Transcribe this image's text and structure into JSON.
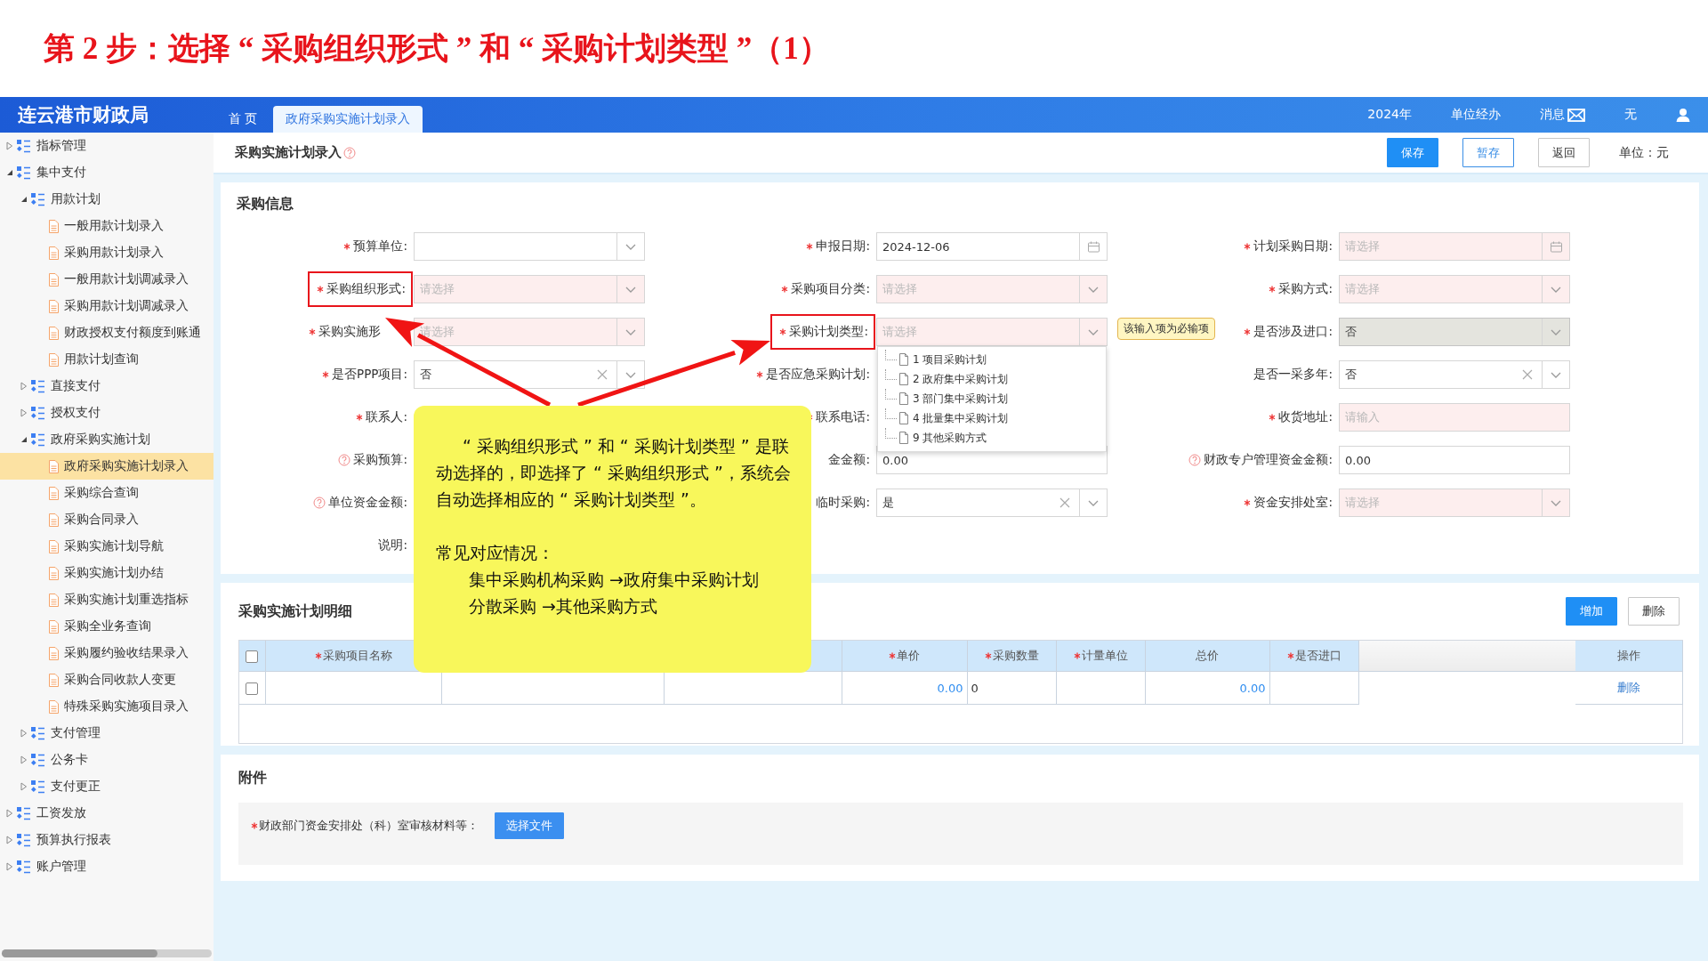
{
  "slide_title": "第 2 步：选择 “ 采购组织形式 ” 和 “ 采购计划类型 ”（1）",
  "header": {
    "logo": "连云港市财政局",
    "tabs": [
      {
        "label": "首 页",
        "selected": false
      },
      {
        "label": "政府采购实施计划录入",
        "selected": true
      }
    ],
    "items": [
      {
        "kind": "text",
        "text": "2024年"
      },
      {
        "kind": "text",
        "text": "单位经办"
      },
      {
        "kind": "message",
        "text": "消息"
      },
      {
        "kind": "text",
        "text": "无"
      },
      {
        "kind": "user"
      }
    ]
  },
  "sidebar": {
    "items": [
      {
        "label": "指标管理",
        "kind": "folder",
        "expanded": false,
        "selected": false
      },
      {
        "label": "集中支付",
        "kind": "folder",
        "expanded": true,
        "selected": false,
        "children": [
          {
            "label": "用款计划",
            "kind": "folder",
            "expanded": true,
            "selected": false,
            "children": [
              {
                "label": "一般用款计划录入",
                "kind": "page",
                "selected": false
              },
              {
                "label": "采购用款计划录入",
                "kind": "page",
                "selected": false
              },
              {
                "label": "一般用款计划调减录入",
                "kind": "page",
                "selected": false
              },
              {
                "label": "采购用款计划调减录入",
                "kind": "page",
                "selected": false
              },
              {
                "label": "财政授权支付额度到账通",
                "kind": "page",
                "selected": false
              },
              {
                "label": "用款计划查询",
                "kind": "page",
                "selected": false
              }
            ]
          },
          {
            "label": "直接支付",
            "kind": "folder",
            "expanded": false,
            "selected": false
          },
          {
            "label": "授权支付",
            "kind": "folder",
            "expanded": false,
            "selected": false
          },
          {
            "label": "政府采购实施计划",
            "kind": "folder",
            "expanded": true,
            "selected": false,
            "children": [
              {
                "label": "政府采购实施计划录入",
                "kind": "page",
                "selected": true
              },
              {
                "label": "采购综合查询",
                "kind": "page",
                "selected": false
              },
              {
                "label": "采购合同录入",
                "kind": "page",
                "selected": false
              },
              {
                "label": "采购实施计划导航",
                "kind": "page",
                "selected": false
              },
              {
                "label": "采购实施计划办结",
                "kind": "page",
                "selected": false
              },
              {
                "label": "采购实施计划重选指标",
                "kind": "page",
                "selected": false
              },
              {
                "label": "采购全业务查询",
                "kind": "page",
                "selected": false
              },
              {
                "label": "采购履约验收结果录入",
                "kind": "page",
                "selected": false
              },
              {
                "label": "采购合同收款人变更",
                "kind": "page",
                "selected": false
              },
              {
                "label": "特殊采购实施项目录入",
                "kind": "page",
                "selected": false
              }
            ]
          },
          {
            "label": "支付管理",
            "kind": "folder",
            "expanded": false,
            "selected": false
          },
          {
            "label": "公务卡",
            "kind": "folder",
            "expanded": false,
            "selected": false
          },
          {
            "label": "支付更正",
            "kind": "folder",
            "expanded": false,
            "selected": false
          }
        ]
      },
      {
        "label": "工资发放",
        "kind": "folder",
        "expanded": false,
        "selected": false
      },
      {
        "label": "预算执行报表",
        "kind": "folder",
        "expanded": false,
        "selected": false
      },
      {
        "label": "账户管理",
        "kind": "folder",
        "expanded": false,
        "selected": false
      }
    ]
  },
  "toolbar": {
    "title": "采购实施计划录入",
    "buttons": [
      {
        "label": "保存",
        "kind": "primary"
      },
      {
        "label": "暂存",
        "kind": "outline"
      },
      {
        "label": "返回",
        "kind": "default"
      }
    ],
    "unit": "单位：元"
  },
  "form": {
    "title": "采购信息",
    "fields": [
      {
        "label": "预算单位:",
        "required": true,
        "help": false,
        "kind": "select",
        "invalid": false,
        "disabled": false,
        "highlighted": false,
        "clearable": false
      },
      {
        "label": "申报日期:",
        "required": true,
        "help": false,
        "kind": "date",
        "value": "2024-12-06",
        "invalid": false,
        "disabled": false,
        "highlighted": false,
        "clearable": false
      },
      {
        "label": "计划采购日期:",
        "required": true,
        "help": false,
        "kind": "date",
        "placeholder": "请选择",
        "invalid": true,
        "disabled": false,
        "highlighted": false,
        "clearable": false
      },
      {
        "label": "采购组织形式:",
        "required": true,
        "help": false,
        "kind": "select",
        "placeholder": "请选择",
        "invalid": true,
        "disabled": false,
        "highlighted": true,
        "clearable": false
      },
      {
        "label": "采购项目分类:",
        "required": true,
        "help": false,
        "kind": "select",
        "placeholder": "请选择",
        "invalid": true,
        "disabled": false,
        "highlighted": false,
        "clearable": false
      },
      {
        "label": "采购方式:",
        "required": true,
        "help": false,
        "kind": "select",
        "placeholder": "请选择",
        "invalid": true,
        "disabled": false,
        "highlighted": false,
        "clearable": false
      },
      {
        "label": "采购实施形",
        "required": true,
        "help": false,
        "kind": "select",
        "placeholder": "请选择",
        "invalid": true,
        "disabled": false,
        "highlighted": false,
        "clearable": false
      },
      {
        "label": "采购计划类型:",
        "required": true,
        "help": false,
        "kind": "select",
        "placeholder": "请选择",
        "invalid": true,
        "disabled": false,
        "highlighted": true,
        "clearable": false,
        "dropdown": {
          "options": [
            "1 项目采购计划",
            "2 政府集中采购计划",
            "3 部门集中采购计划",
            "4 批量集中采购计划",
            "9 其他采购方式"
          ]
        },
        "tooltip": "该输入项为必输项"
      },
      {
        "label": "是否涉及进口:",
        "required": true,
        "help": false,
        "kind": "select",
        "value": "否",
        "invalid": false,
        "disabled": true,
        "highlighted": false,
        "clearable": false
      },
      {
        "label": "是否PPP项目:",
        "required": true,
        "help": false,
        "kind": "select",
        "value": "否",
        "invalid": false,
        "disabled": false,
        "highlighted": false,
        "clearable": true
      },
      {
        "label": "是否应急采购计划:",
        "required": true,
        "help": false
      },
      {
        "label": "是否一采多年:",
        "required": false,
        "help": false,
        "kind": "select",
        "value": "否",
        "invalid": false,
        "disabled": false,
        "highlighted": false,
        "clearable": true
      },
      {
        "label": "联系人:",
        "required": true,
        "help": false
      },
      {
        "label": "联系电话:",
        "required": true,
        "help": false
      },
      {
        "label": "收货地址:",
        "required": true,
        "help": false,
        "kind": "input",
        "placeholder": "请输入",
        "invalid": true,
        "disabled": false,
        "highlighted": false,
        "clearable": false
      },
      {
        "label": "采购预算:",
        "required": false,
        "help": true
      },
      {
        "label": "金金额:",
        "kind": "input",
        "value": "0.00",
        "invalid": false,
        "disabled": false,
        "highlighted": false,
        "clearable": false
      },
      {
        "label": "财政专户管理资金金额:",
        "required": false,
        "help": true,
        "kind": "input",
        "value": "0.00",
        "invalid": false,
        "disabled": false,
        "highlighted": false,
        "clearable": false
      },
      {
        "label": "单位资金金额:",
        "required": false,
        "help": true
      },
      {
        "label": "临时采购:",
        "kind": "select",
        "value": "是",
        "invalid": false,
        "disabled": false,
        "highlighted": false,
        "clearable": true
      },
      {
        "label": "资金安排处室:",
        "required": true,
        "help": false,
        "kind": "select",
        "placeholder": "请选择",
        "invalid": true,
        "disabled": false,
        "highlighted": false,
        "clearable": false
      },
      {
        "label": "说明:",
        "required": false,
        "help": false
      }
    ]
  },
  "detail": {
    "title": "采购实施计划明细",
    "buttons": [
      {
        "label": "增加",
        "kind": "primary"
      },
      {
        "label": "删除",
        "kind": "default"
      }
    ],
    "header_checked": false,
    "columns": [
      {
        "label": "采购项目名称",
        "required": true
      },
      null,
      null,
      {
        "label": "单价",
        "required": true
      },
      {
        "label": "采购数量",
        "required": true
      },
      {
        "label": "计量单位",
        "required": true
      },
      {
        "label": "总价",
        "required": false
      },
      {
        "label": "是否进口",
        "required": true
      }
    ],
    "action_column": "操作",
    "rows": [
      {
        "checked": false,
        "cells": [
          null,
          null,
          null,
          {
            "kind": "amount",
            "text": "0.00"
          },
          {
            "kind": "number",
            "text": "0"
          },
          null,
          {
            "kind": "amount",
            "text": "0.00"
          },
          null
        ],
        "action": "删除"
      }
    ]
  },
  "attachments": {
    "title": "附件",
    "label": "财政部门资金安排处（科）室审核材料等：",
    "required": true,
    "button": "选择文件"
  },
  "note": {
    "paragraphs": [
      {
        "kind": "body",
        "text": "“ 采购组织形式 ” 和 “ 采购计划类型 ” 是联动选择的，即选择了 “ 采购组织形式 ”，系统会自动选择相应的 “ 采购计划类型 ”。"
      },
      {
        "kind": "heading",
        "text": "常见对应情况："
      },
      {
        "kind": "item",
        "text": "集中采购机构采购 →政府集中采购计划"
      },
      {
        "kind": "item",
        "text": "分散采购 →其他采购方式"
      }
    ]
  }
}
